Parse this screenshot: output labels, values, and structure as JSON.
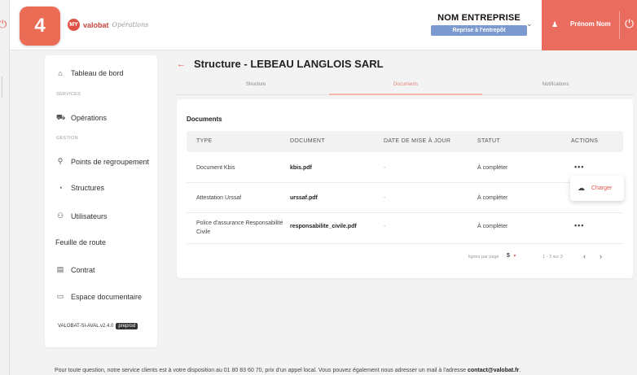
{
  "step_badge": "4",
  "brand": {
    "logo_mark": "MY",
    "name": "valobat",
    "script": "Opérations"
  },
  "company": {
    "name": "NOM ENTREPRISE",
    "reprise": "Reprise à l'entrepôt"
  },
  "user": {
    "name": "Prénom Nom"
  },
  "sidebar": {
    "dashboard": "Tableau de bord",
    "services_section": "SERVICES",
    "operations": "Opérations",
    "gestion_section": "GESTION",
    "points": "Points de regroupement",
    "structures": "Structures",
    "users": "Utilisateurs",
    "roadmap": "Feuille de route",
    "contract": "Contrat",
    "documents_space": "Espace documentaire",
    "version": "VALOBAT-SI-AVAL v2.4.0",
    "env": "preprod"
  },
  "page": {
    "back_icon": "arrow-left",
    "title": "Structure - LEBEAU LANGLOIS SARL",
    "tabs": [
      "Structure",
      "Documents",
      "Notifications"
    ],
    "active_tab": "Documents"
  },
  "documents": {
    "title": "Documents",
    "headers": [
      "TYPE",
      "DOCUMENT",
      "DATE DE MISE À JOUR",
      "STATUT",
      "ACTIONS"
    ],
    "rows": [
      {
        "type": "Document Kbis",
        "document": "kbis.pdf",
        "date": "-",
        "status": "À compléter",
        "action": "•••"
      },
      {
        "type": "Attestation Urssaf",
        "document": "urssaf.pdf",
        "date": "-",
        "status": "À compléter",
        "action": ""
      },
      {
        "type": "Police d'assurance Responsabilité Civile",
        "document": "responsabilite_civile.pdf",
        "date": "-",
        "status": "À compléter",
        "action": "•••"
      }
    ],
    "popover": {
      "icon": "cloud-upload",
      "label": "Charger"
    },
    "pagination": {
      "rows_label": "lignes par page",
      "rows_value": "5",
      "range": "1 - 3 sur 3"
    }
  },
  "footer": {
    "text": "Pour toute question, notre service clients est à votre disposition au 01 80 83 60 70, prix d'un appel local. Vous pouvez également nous adresser un mail à l'adresse ",
    "email": "contact@valobat.fr",
    "end": "."
  },
  "colors": {
    "accent": "#ea6c5e",
    "reprise": "#7d9ad0",
    "badge": "#ea6c54"
  }
}
